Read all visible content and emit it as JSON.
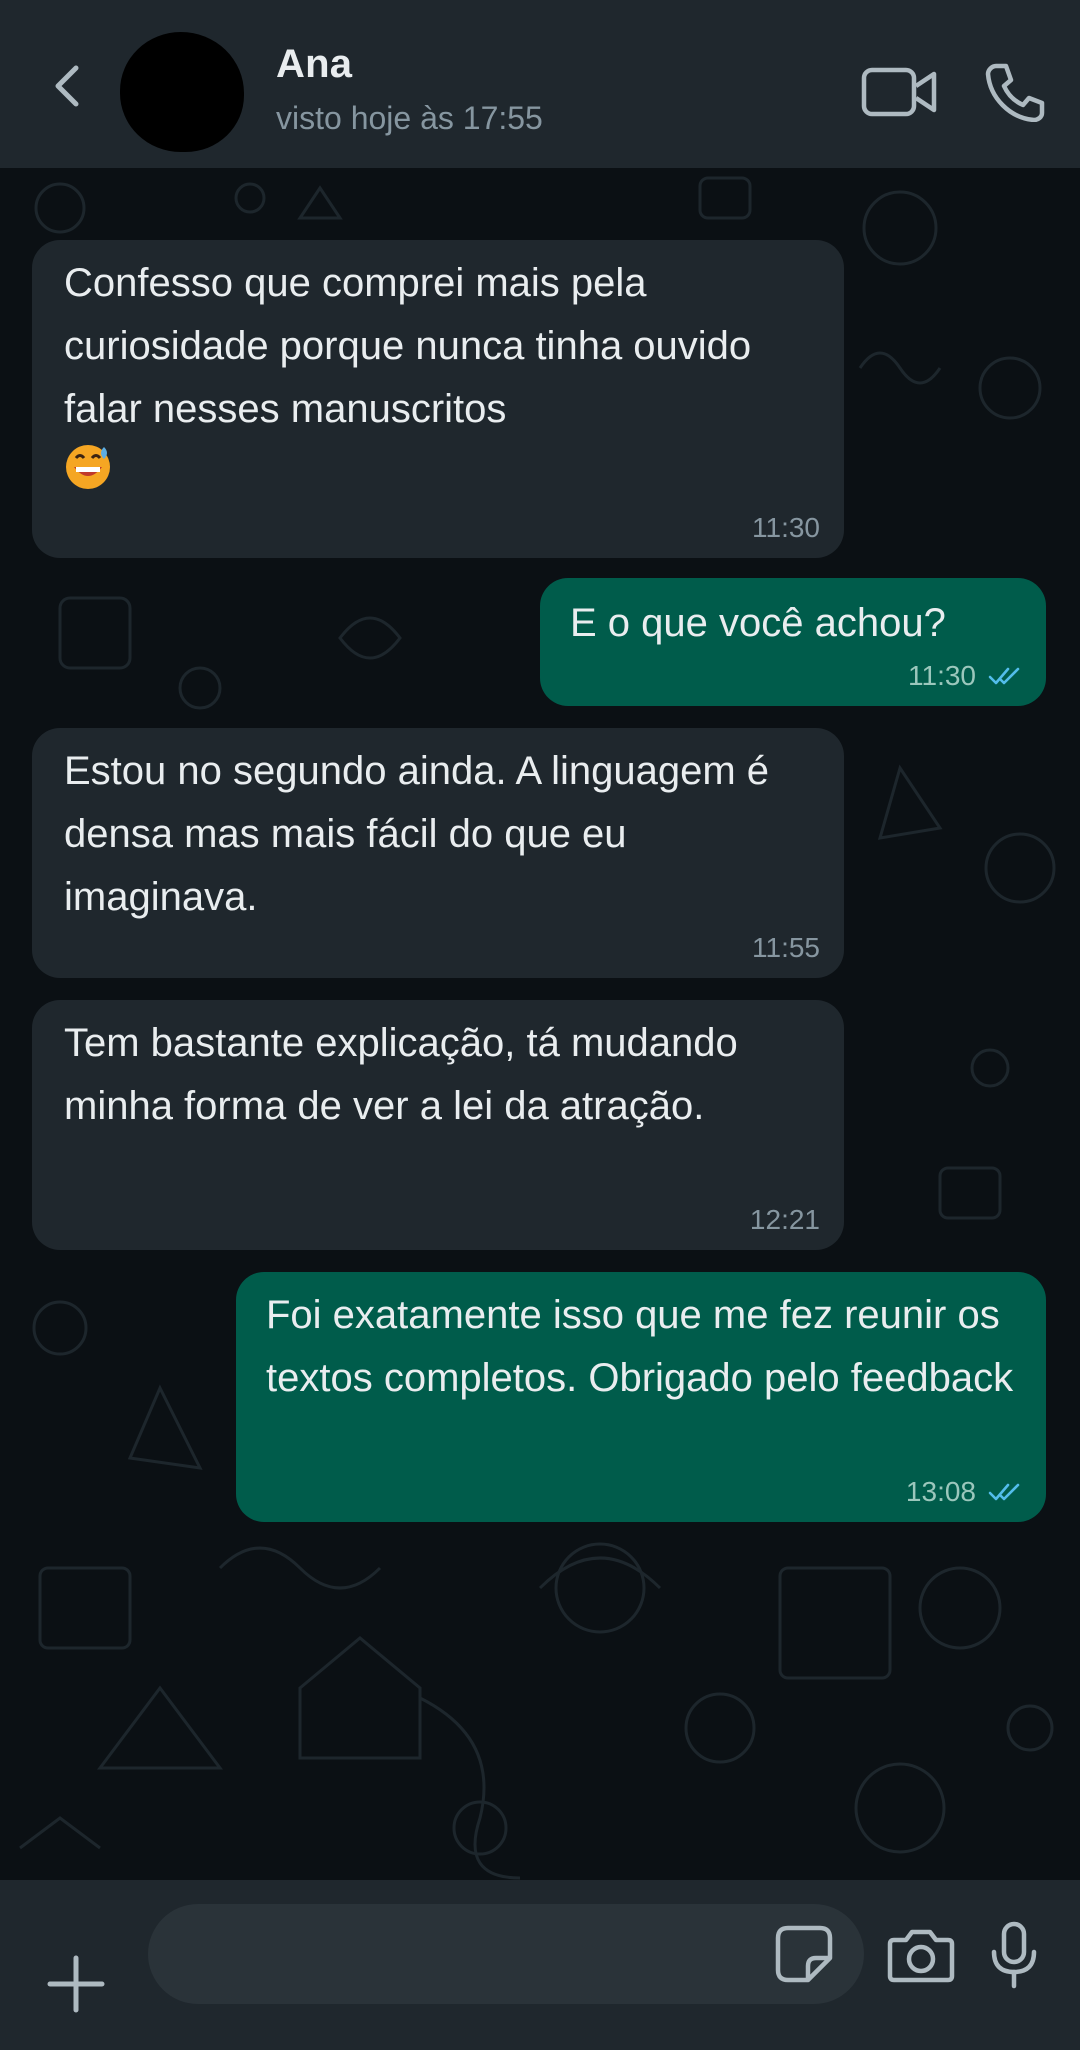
{
  "header": {
    "contact_name": "Ana",
    "last_seen": "visto hoje às 17:55",
    "icons": [
      "back-arrow-icon",
      "video-call-icon",
      "phone-call-icon"
    ]
  },
  "messages": [
    {
      "direction": "incoming",
      "text": "Confesso que comprei mais pela curiosidade porque nunca tinha ouvido falar nesses manuscritos",
      "emoji": "grinning-face-with-sweat",
      "time": "11:30"
    },
    {
      "direction": "outgoing",
      "text": "E o que você achou?",
      "time": "11:30",
      "status": "read"
    },
    {
      "direction": "incoming",
      "text": "Estou no segundo ainda. A linguagem é densa mas mais fácil do que eu imaginava.",
      "time": "11:55"
    },
    {
      "direction": "incoming",
      "text": "Tem bastante explicação, tá mudando minha forma de ver a lei da atração.",
      "time": "12:21"
    },
    {
      "direction": "outgoing",
      "text": "Foi exatamente isso que me fez reunir os textos completos. Obrigado pelo feedback",
      "time": "13:08",
      "status": "read"
    }
  ],
  "composer": {
    "value": "",
    "placeholder": "",
    "icons": [
      "plus-icon",
      "sticker-icon",
      "camera-icon",
      "microphone-icon"
    ]
  },
  "colors": {
    "header_bg": "#1f272d",
    "chat_bg": "#0b1014",
    "incoming_bubble": "#1f272d",
    "outgoing_bubble": "#005c4b",
    "read_tick": "#53bdeb"
  }
}
